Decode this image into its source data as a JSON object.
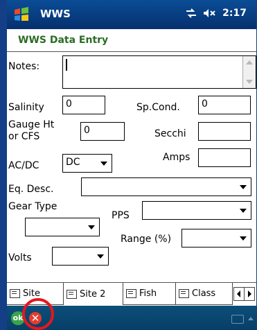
{
  "titlebar": {
    "app_title": "WWS",
    "time": "2:17"
  },
  "form": {
    "header": "WWS Data Entry",
    "notes_label": "Notes:",
    "notes_value": "",
    "salinity_label": "Salinity",
    "salinity_value": "0",
    "spcond_label": "Sp.Cond.",
    "spcond_value": "0",
    "gauge_label_1": "Gauge Ht",
    "gauge_label_2": "or CFS",
    "gauge_value": "0",
    "secchi_label": "Secchi",
    "secchi_value": "",
    "acdc_label": "AC/DC",
    "acdc_value": "DC",
    "amps_label": "Amps",
    "amps_value": "",
    "eqdesc_label": "Eq. Desc.",
    "eqdesc_value": "",
    "geartype_label": "Gear Type",
    "geartype_value": "",
    "pps_label": "PPS",
    "pps_value": "",
    "range_label": "Range (%)",
    "range_value": "",
    "volts_label": "Volts",
    "volts_value": ""
  },
  "tabs": [
    {
      "label": "Site"
    },
    {
      "label": "Site 2"
    },
    {
      "label": "Fish"
    },
    {
      "label": "Class"
    }
  ],
  "bottombar": {
    "ok_label": "ok",
    "cancel_symbol": "✕"
  },
  "icons": {
    "start": "windows-flag-icon",
    "connectivity": "connectivity-icon",
    "volume": "speaker-muted-icon",
    "keyboard": "keyboard-icon"
  },
  "colors": {
    "title_bar": "#0a4d96",
    "header_text": "#2a6c23",
    "highlight_ring": "#e5161e",
    "ok": "#3aa34b",
    "cancel": "#e63b2e"
  }
}
